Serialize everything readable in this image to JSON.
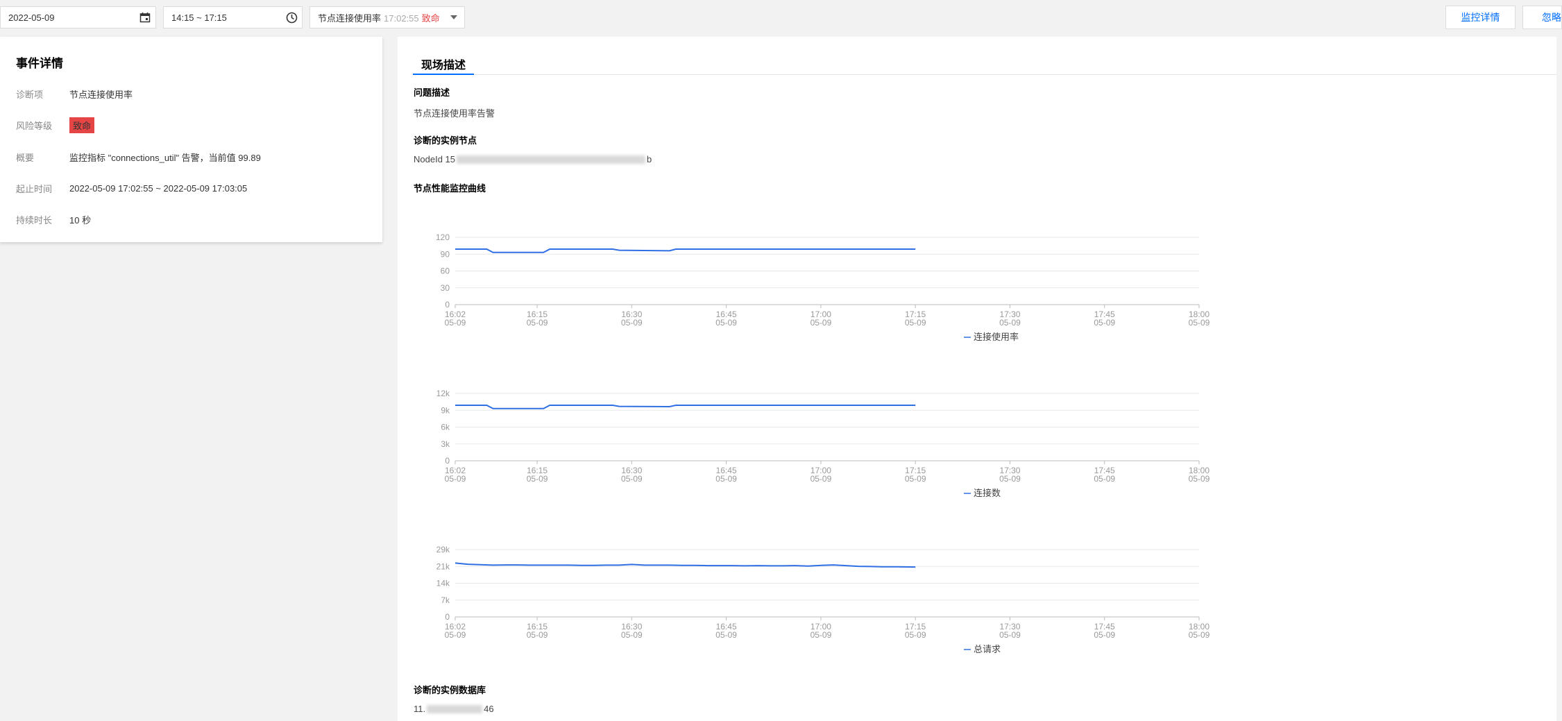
{
  "toolbar": {
    "date_value": "2022-05-09",
    "time_value": "14:15 ~ 17:15",
    "event_select": {
      "name": "节点连接使用率",
      "time": "17:02:55",
      "severity": "致命"
    },
    "monitor_button": "监控详情",
    "ignore_button": "忽略",
    "icons": [
      "calendar-icon",
      "clock-icon",
      "caret-down-icon"
    ],
    "colors": {
      "accent": "#006eff",
      "danger": "#e54545"
    }
  },
  "event_details": {
    "title": "事件详情",
    "rows": [
      {
        "label": "诊断项",
        "value": "节点连接使用率"
      },
      {
        "label": "风险等级",
        "value": "致命"
      },
      {
        "label": "概要",
        "value": "监控指标 \"connections_util\" 告警，当前值 99.89"
      },
      {
        "label": "起止时间",
        "value": "2022-05-09 17:02:55 ~ 2022-05-09 17:03:05"
      },
      {
        "label": "持续时长",
        "value": "10 秒"
      }
    ]
  },
  "scene": {
    "tab": "现场描述",
    "problem_title": "问题描述",
    "problem_text": "节点连接使用率告警",
    "node_title": "诊断的实例节点",
    "node_prefix": "NodeId 15",
    "node_suffix": "b",
    "curve_title": "节点性能监控曲线",
    "db_title": "诊断的实例数据库",
    "db_prefix": "11.",
    "db_suffix": "46"
  },
  "chart_data": [
    {
      "type": "line",
      "x_ticks": [
        [
          "16:02",
          "05-09"
        ],
        [
          "16:15",
          "05-09"
        ],
        [
          "16:30",
          "05-09"
        ],
        [
          "16:45",
          "05-09"
        ],
        [
          "17:00",
          "05-09"
        ],
        [
          "17:15",
          "05-09"
        ],
        [
          "17:30",
          "05-09"
        ],
        [
          "17:45",
          "05-09"
        ],
        [
          "18:00",
          "05-09"
        ]
      ],
      "x_minutes": [
        0,
        13,
        28,
        43,
        58,
        73,
        88,
        103,
        118
      ],
      "y_ticks": [
        "0",
        "30",
        "60",
        "90",
        "120"
      ],
      "ylim": [
        0,
        120
      ],
      "series": [
        {
          "name": "连接使用率",
          "color": "#2f6fe4",
          "x": [
            0,
            5,
            6,
            14,
            15,
            25,
            26,
            34,
            35,
            73
          ],
          "y": [
            99,
            99,
            93,
            93,
            99,
            99,
            97,
            96,
            99,
            99
          ]
        }
      ]
    },
    {
      "type": "line",
      "x_ticks": [
        [
          "16:02",
          "05-09"
        ],
        [
          "16:15",
          "05-09"
        ],
        [
          "16:30",
          "05-09"
        ],
        [
          "16:45",
          "05-09"
        ],
        [
          "17:00",
          "05-09"
        ],
        [
          "17:15",
          "05-09"
        ],
        [
          "17:30",
          "05-09"
        ],
        [
          "17:45",
          "05-09"
        ],
        [
          "18:00",
          "05-09"
        ]
      ],
      "x_minutes": [
        0,
        13,
        28,
        43,
        58,
        73,
        88,
        103,
        118
      ],
      "y_ticks": [
        "0",
        "3k",
        "6k",
        "9k",
        "12k"
      ],
      "ylim": [
        0,
        12000
      ],
      "series": [
        {
          "name": "连接数",
          "color": "#2f6fe4",
          "x": [
            0,
            5,
            6,
            14,
            15,
            25,
            26,
            34,
            35,
            73
          ],
          "y": [
            9900,
            9900,
            9300,
            9300,
            9900,
            9900,
            9700,
            9650,
            9900,
            9900
          ]
        }
      ]
    },
    {
      "type": "line",
      "x_ticks": [
        [
          "16:02",
          "05-09"
        ],
        [
          "16:15",
          "05-09"
        ],
        [
          "16:30",
          "05-09"
        ],
        [
          "16:45",
          "05-09"
        ],
        [
          "17:00",
          "05-09"
        ],
        [
          "17:15",
          "05-09"
        ],
        [
          "17:30",
          "05-09"
        ],
        [
          "17:45",
          "05-09"
        ],
        [
          "18:00",
          "05-09"
        ]
      ],
      "x_minutes": [
        0,
        13,
        28,
        43,
        58,
        73,
        88,
        103,
        118
      ],
      "y_ticks": [
        "0",
        "7k",
        "14k",
        "21k",
        "29k"
      ],
      "ylim": [
        0,
        29000
      ],
      "series": [
        {
          "name": "总请求",
          "color": "#2f6fe4",
          "x": [
            0,
            2,
            4,
            6,
            8,
            10,
            12,
            14,
            16,
            18,
            20,
            22,
            24,
            26,
            28,
            30,
            32,
            34,
            36,
            38,
            40,
            42,
            44,
            46,
            48,
            50,
            52,
            54,
            56,
            58,
            60,
            62,
            64,
            66,
            68,
            70,
            73
          ],
          "y": [
            23200,
            22700,
            22500,
            22300,
            22400,
            22400,
            22300,
            22300,
            22300,
            22300,
            22200,
            22200,
            22300,
            22300,
            22600,
            22300,
            22300,
            22300,
            22200,
            22200,
            22100,
            22100,
            22100,
            22000,
            22100,
            22000,
            22000,
            22100,
            21900,
            22200,
            22400,
            22100,
            21800,
            21700,
            21600,
            21600,
            21500
          ]
        }
      ]
    }
  ]
}
